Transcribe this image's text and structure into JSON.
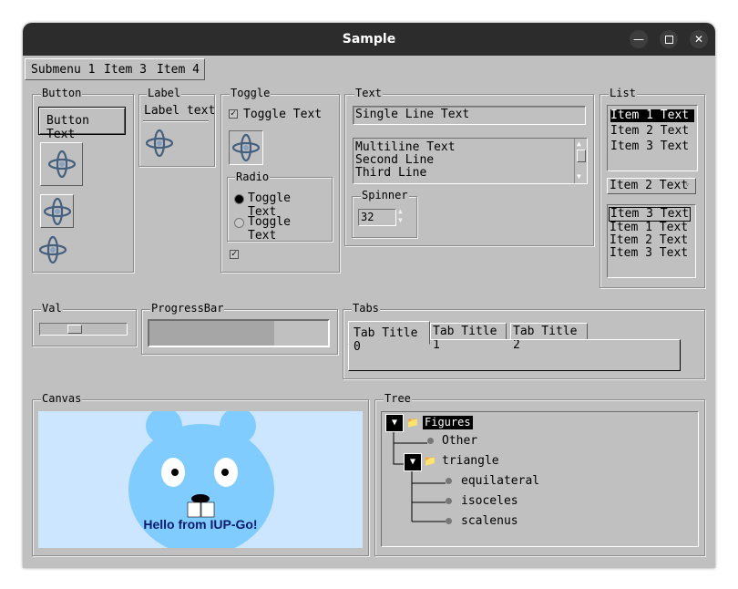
{
  "window": {
    "title": "Sample",
    "minimize_icon": "minimize-icon",
    "maximize_icon": "maximize-icon",
    "close_icon": "close-icon"
  },
  "menu": [
    "Submenu 1",
    "Item 3",
    "Item 4"
  ],
  "button_frame": {
    "title": "Button",
    "button_label": "Button Text",
    "image_icon": "atom-icon"
  },
  "label_frame": {
    "title": "Label",
    "text": "Label text"
  },
  "toggle_frame": {
    "title": "Toggle",
    "toggle_label": "Toggle Text",
    "toggle_checked": true,
    "radio_title": "Radio",
    "radio_options": [
      "Toggle Text",
      "Toggle Text"
    ],
    "radio_selected": 0,
    "bottom_checked": true
  },
  "text_frame": {
    "title": "Text",
    "single_line": "Single Line Text",
    "multiline": "Multiline Text\nSecond Line\nThird Line",
    "spinner_title": "Spinner",
    "spinner_value": "32"
  },
  "list_frame": {
    "title": "List",
    "list1": [
      "Item 1 Text",
      "Item 2 Text",
      "Item 3 Text"
    ],
    "list1_selected": 0,
    "dropdown_value": "Item 2 Text",
    "list2": [
      "Item 3 Text",
      "Item 1 Text",
      "Item 2 Text",
      "Item 3 Text"
    ],
    "list2_selected": 0
  },
  "val_frame": {
    "title": "Val",
    "value": 0.25
  },
  "progress_frame": {
    "title": "ProgressBar",
    "value": 0.7
  },
  "tabs_frame": {
    "title": "Tabs",
    "tabs": [
      "Tab Title 0",
      "Tab Title 1",
      "Tab Title 2"
    ],
    "active": 0
  },
  "canvas_frame": {
    "title": "Canvas",
    "text": "Hello from IUP-Go!",
    "bg_color": "#cce6ff",
    "face_color": "#80ccff"
  },
  "tree_frame": {
    "title": "Tree",
    "root": "Figures",
    "other": "Other",
    "branch": "triangle",
    "leaves": [
      "equilateral",
      "isoceles",
      "scalenus"
    ]
  }
}
